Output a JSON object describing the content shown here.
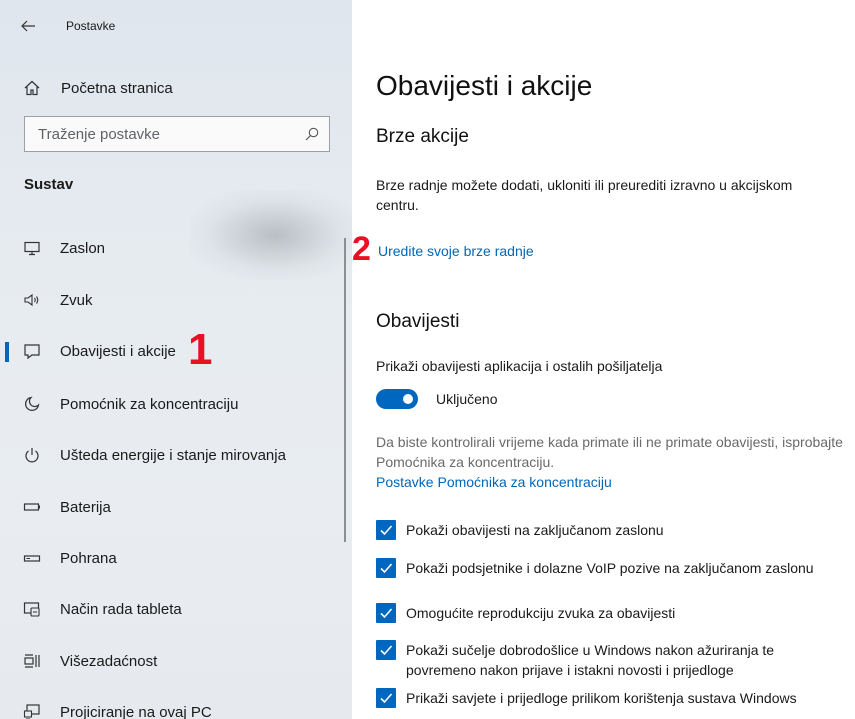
{
  "window": {
    "title": "Postavke"
  },
  "sidebar": {
    "home_label": "Početna stranica",
    "search_placeholder": "Traženje postavke",
    "section_label": "Sustav",
    "items": [
      {
        "label": "Zaslon",
        "icon": "monitor-icon"
      },
      {
        "label": "Zvuk",
        "icon": "speaker-icon"
      },
      {
        "label": "Obavijesti i akcije",
        "icon": "notification-icon",
        "selected": true
      },
      {
        "label": "Pomoćnik za koncentraciju",
        "icon": "moon-icon"
      },
      {
        "label": "Ušteda energije i stanje mirovanja",
        "icon": "power-icon"
      },
      {
        "label": "Baterija",
        "icon": "battery-icon"
      },
      {
        "label": "Pohrana",
        "icon": "storage-icon"
      },
      {
        "label": "Način rada tableta",
        "icon": "tablet-mode-icon"
      },
      {
        "label": "Višezadaćnost",
        "icon": "multitasking-icon"
      },
      {
        "label": "Projiciranje na ovaj PC",
        "icon": "projecting-icon"
      }
    ]
  },
  "annotations": {
    "one": "1",
    "two": "2"
  },
  "main": {
    "title": "Obavijesti i akcije",
    "quick_actions": {
      "heading": "Brze akcije",
      "description": "Brze radnje možete dodati, ukloniti ili preurediti izravno u akcijskom centru.",
      "link": "Uredite svoje brze radnje"
    },
    "notifications": {
      "heading": "Obavijesti",
      "toggle_caption": "Prikaži obavijesti aplikacija i ostalih pošiljatelja",
      "toggle_state": "Uključeno",
      "toggle_on": true,
      "info": "Da biste kontrolirali vrijeme kada primate ili ne primate obavijesti, isprobajte Pomoćnika za koncentraciju.",
      "info_link": "Postavke Pomoćnika za koncentraciju",
      "checkboxes": [
        {
          "label": "Pokaži obavijesti na zaključanom zaslonu",
          "checked": true
        },
        {
          "label": "Pokaži podsjetnike i dolazne VoIP pozive na zaključanom zaslonu",
          "checked": true
        },
        {
          "label": "Omogućite reprodukciju zvuka za obavijesti",
          "checked": true
        },
        {
          "label": "Pokaži sučelje dobrodošlice u Windows nakon ažuriranja te povremeno nakon prijave i istakni novosti i prijedloge",
          "checked": true
        },
        {
          "label": "Prikaži savjete i prijedloge prilikom korištenja sustava Windows",
          "checked": true
        }
      ]
    }
  },
  "colors": {
    "accent": "#0067c0",
    "link": "#0067b8",
    "annotation": "#e81123"
  }
}
